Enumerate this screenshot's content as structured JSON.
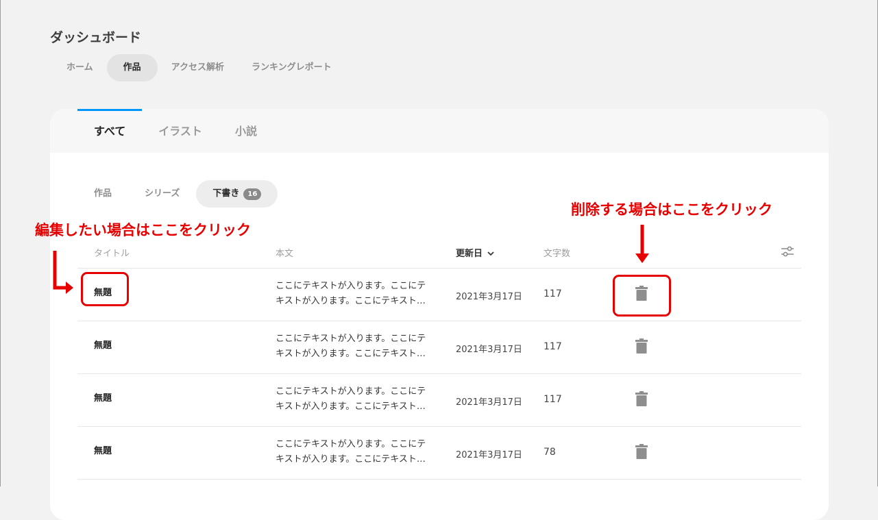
{
  "header": {
    "title": "ダッシュボード"
  },
  "main_tabs": [
    {
      "label": "ホーム",
      "active": false
    },
    {
      "label": "作品",
      "active": true
    },
    {
      "label": "アクセス解析",
      "active": false
    },
    {
      "label": "ランキングレポート",
      "active": false
    }
  ],
  "category_tabs": [
    {
      "label": "すべて",
      "active": true
    },
    {
      "label": "イラスト",
      "active": false
    },
    {
      "label": "小説",
      "active": false
    }
  ],
  "sub_tabs": [
    {
      "label": "作品",
      "active": false
    },
    {
      "label": "シリーズ",
      "active": false
    },
    {
      "label": "下書き",
      "active": true,
      "badge": "16"
    }
  ],
  "table": {
    "columns": {
      "title": "タイトル",
      "body": "本文",
      "updated": "更新日",
      "chars": "文字数"
    },
    "rows": [
      {
        "title": "無題",
        "body_line1": "ここにテキストが入ります。ここにテ",
        "body_line2": "キストが入ります。ここにテキスト…",
        "updated": "2021年3月17日",
        "chars": "117"
      },
      {
        "title": "無題",
        "body_line1": "ここにテキストが入ります。ここにテ",
        "body_line2": "キストが入ります。ここにテキスト…",
        "updated": "2021年3月17日",
        "chars": "117"
      },
      {
        "title": "無題",
        "body_line1": "ここにテキストが入ります。ここにテ",
        "body_line2": "キストが入ります。ここにテキスト…",
        "updated": "2021年3月17日",
        "chars": "117"
      },
      {
        "title": "無題",
        "body_line1": "ここにテキストが入ります。ここにテ",
        "body_line2": "キストが入ります。ここにテキスト…",
        "updated": "2021年3月17日",
        "chars": "78"
      }
    ]
  },
  "annotations": {
    "edit": "編集したい場合はここをクリック",
    "delete": "削除する場合はここをクリック",
    "color": "#e60000"
  },
  "colors": {
    "accent": "#0096fa",
    "background": "#f2f2f2"
  },
  "icons": {
    "delete": "trash-icon",
    "filter": "sliders-icon",
    "sort": "chevron-down-icon"
  }
}
